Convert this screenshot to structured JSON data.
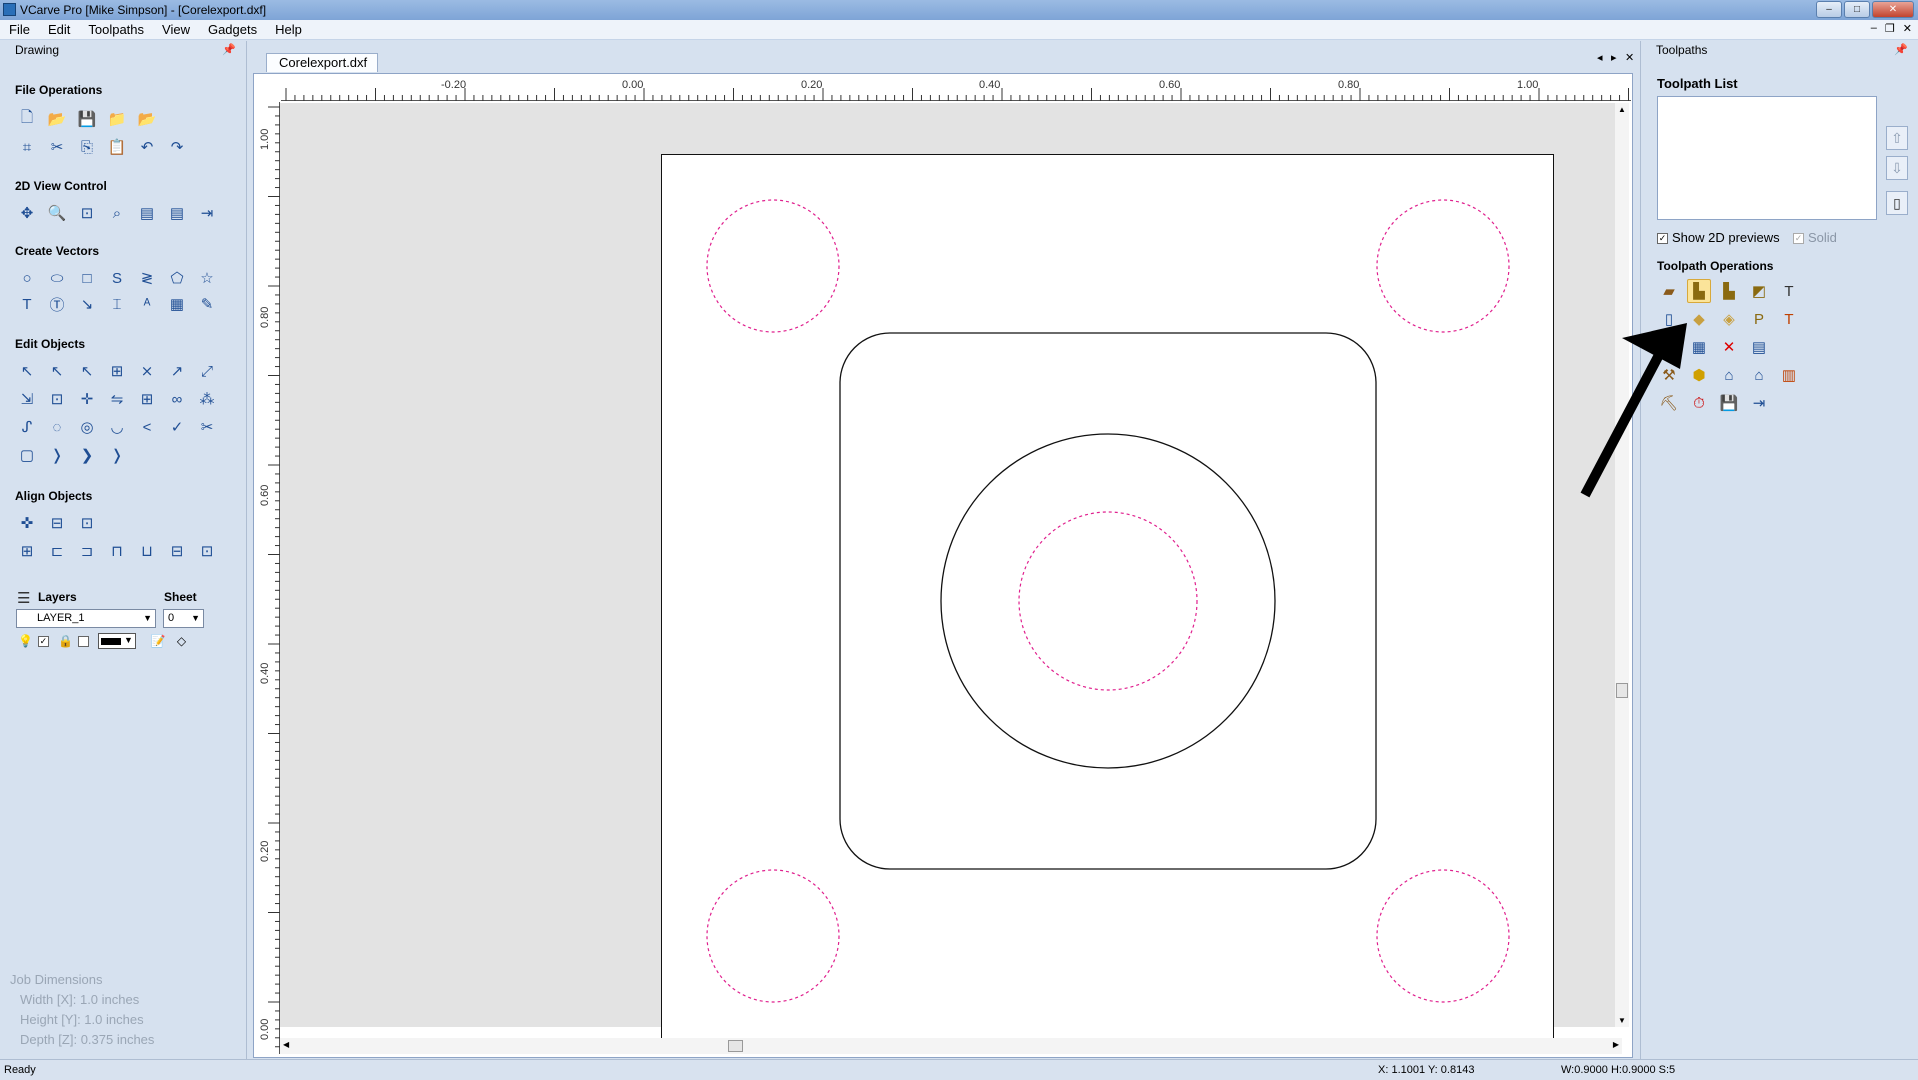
{
  "window": {
    "title": "VCarve Pro [Mike Simpson] - [Corelexport.dxf]"
  },
  "menu": [
    "File",
    "Edit",
    "Toolpaths",
    "View",
    "Gadgets",
    "Help"
  ],
  "left_panel": {
    "title": "Drawing",
    "sections": {
      "file_ops": "File Operations",
      "view_ctrl": "2D View Control",
      "create_vectors": "Create Vectors",
      "edit_objects": "Edit Objects",
      "align_objects": "Align Objects"
    },
    "layers": {
      "label": "Layers",
      "sheet_label": "Sheet",
      "layer_value": "LAYER_1",
      "sheet_value": "0"
    },
    "job_dimensions": {
      "title": "Job Dimensions",
      "width": "Width  [X]: 1.0 inches",
      "height": "Height [Y]: 1.0 inches",
      "depth": "Depth  [Z]: 0.375 inches"
    }
  },
  "document": {
    "tab": "Corelexport.dxf"
  },
  "ruler": {
    "top": [
      "-0.20",
      "0.00",
      "0.20",
      "0.40",
      "0.60",
      "0.80",
      "1.00"
    ],
    "left": [
      "1.00",
      "0.80",
      "0.60",
      "0.40",
      "0.20",
      "0.00"
    ]
  },
  "right_panel": {
    "title": "Toolpaths",
    "list_title": "Toolpath List",
    "show_previews": "Show 2D previews",
    "solid": "Solid",
    "operations_title": "Toolpath Operations"
  },
  "status": {
    "text": "Ready",
    "coords": "X: 1.1001 Y: 0.8143",
    "dims": "W:0.9000  H:0.9000  S:5"
  },
  "colors": {
    "dashed_circles": "#e0208e",
    "highlight": "#fbe49a",
    "panel_bg": "#d6e1ef"
  }
}
